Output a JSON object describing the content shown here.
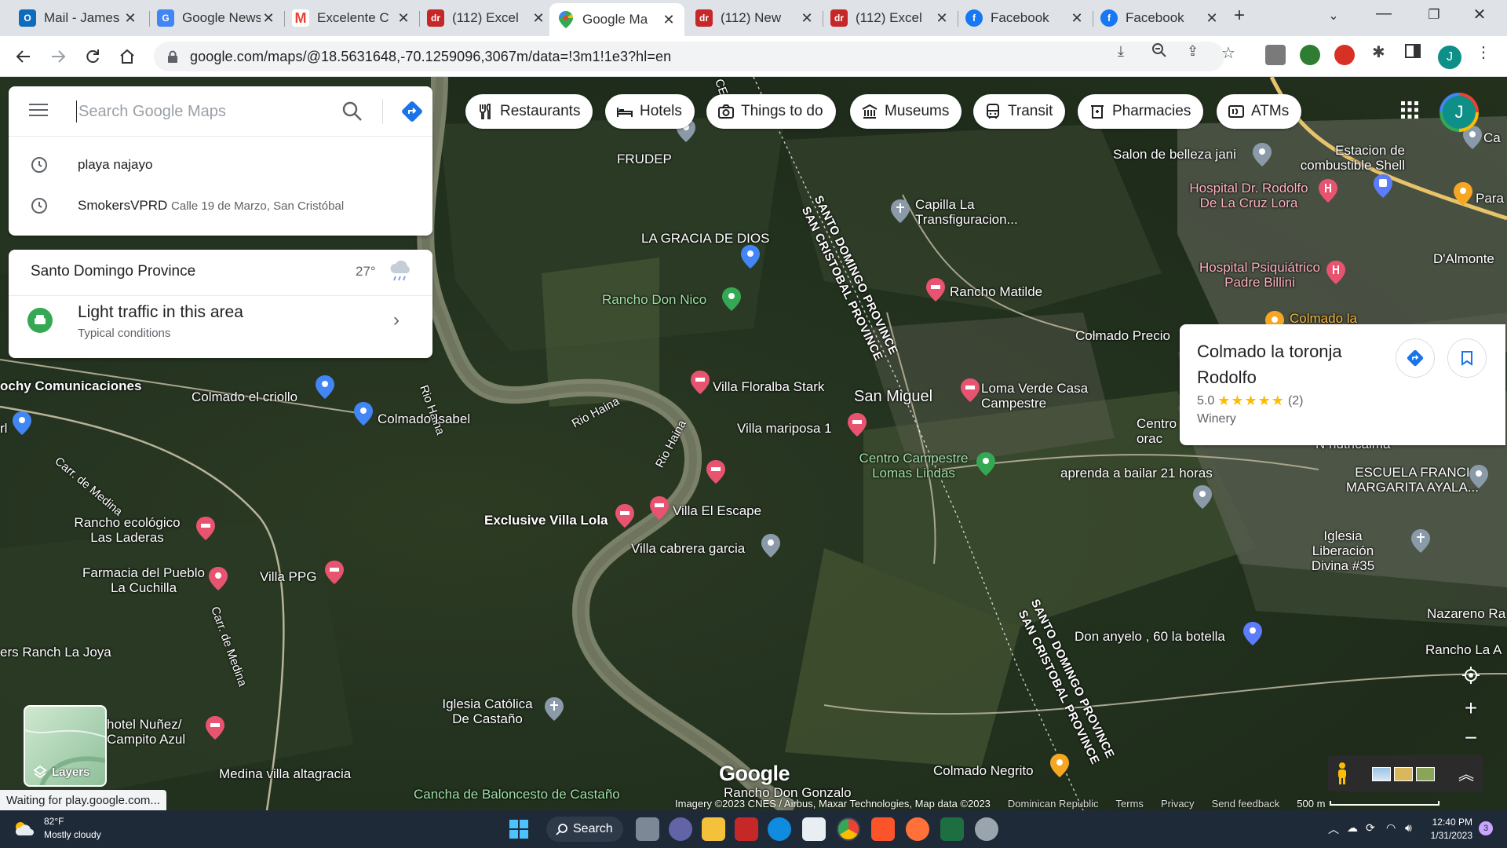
{
  "browser": {
    "tabs": [
      {
        "title": "Mail - James",
        "icon": "outlook-icon",
        "color": "#0f6cbd",
        "glyph": "O"
      },
      {
        "title": "Google News",
        "icon": "google-news-icon",
        "color": "#4285f4",
        "glyph": "G"
      },
      {
        "title": "Excelente C",
        "icon": "gmail-icon",
        "color": "#ea4335",
        "glyph": "M"
      },
      {
        "title": "(112) Excel",
        "icon": "dr-icon",
        "color": "#c62828",
        "glyph": "dr"
      },
      {
        "title": "Google Ma",
        "icon": "google-maps-icon",
        "color": "#34a853",
        "glyph": "◆",
        "active": true
      },
      {
        "title": "(112) New",
        "icon": "dr-icon",
        "color": "#c62828",
        "glyph": "dr"
      },
      {
        "title": "(112) Excel",
        "icon": "dr-icon",
        "color": "#c62828",
        "glyph": "dr"
      },
      {
        "title": "Facebook",
        "icon": "facebook-icon",
        "color": "#1877f2",
        "glyph": "f"
      },
      {
        "title": "Facebook",
        "icon": "facebook-icon",
        "color": "#1877f2",
        "glyph": "f"
      }
    ],
    "new_tab": "+",
    "url": "google.com/maps/@18.5631648,-70.1259096,3067m/data=!3m1!1e3?hl=en",
    "profile_initial": "J"
  },
  "search": {
    "placeholder": "Search Google Maps",
    "recents": [
      {
        "title": "playa najayo",
        "sub": ""
      },
      {
        "title": "SmokersVPRD",
        "sub": "Calle 19 de Marzo, San Cristóbal"
      }
    ]
  },
  "weather_card": {
    "region": "Santo Domingo Province",
    "temperature": "27°",
    "traffic_title": "Light traffic in this area",
    "traffic_sub": "Typical conditions"
  },
  "chips": [
    {
      "label": "Restaurants",
      "icon": "fork-knife-icon"
    },
    {
      "label": "Hotels",
      "icon": "bed-icon"
    },
    {
      "label": "Things to do",
      "icon": "camera-icon"
    },
    {
      "label": "Museums",
      "icon": "museum-icon"
    },
    {
      "label": "Transit",
      "icon": "bus-icon"
    },
    {
      "label": "Pharmacies",
      "icon": "pharmacy-icon"
    },
    {
      "label": "ATMs",
      "icon": "atm-icon"
    }
  ],
  "map_profile_initial": "J",
  "place_card": {
    "name": "Colmado la toronja Rodolfo",
    "rating": "5.0",
    "stars": "★★★★★",
    "reviews": "(2)",
    "category": "Winery"
  },
  "map_labels": {
    "frudep": "FRUDEP",
    "la_gracia": "LA GRACIA DE DIOS",
    "rancho_don_nico": "Rancho Don Nico",
    "capilla": "Capilla La Transfiguracion...",
    "rancho_matilde": "Rancho Matilde",
    "salon": "Salon de belleza jani",
    "estacion": "Estacion de combustible Shell",
    "hospital_cruz": "Hospital Dr. Rodolfo De La Cruz Lora",
    "hospital_psi": "Hospital Psiquiátrico Padre Billini",
    "para": "Para",
    "ca": "Ca",
    "dalmonte": "D'Almonte",
    "colmado_la": "Colmado la",
    "colmado_precio": "Colmado Precio",
    "san_miguel": "San Miguel",
    "loma_verde": "Loma Verde Casa Campestre",
    "villa_floralba": "Villa Floralba Stark",
    "villa_mariposa": "Villa mariposa 1",
    "centro_campestre": "Centro Campestre Lomas Lindas",
    "centro_orac": "Centro orac",
    "aprenda": "aprenda a bailar 21 horas",
    "n_nutricalma": "N nutricalma",
    "escuela": "ESCUELA FRANCIA MARGARITA AYALA...",
    "rio_haina_1": "Rio Haina",
    "rio_haina_2": "Rio Haina",
    "rio_haina_3": "Rio Haina",
    "ochy": "ochy Comunicaciones",
    "colmado_criollo": "Colmado el criollo",
    "colmado_isabel": "Colmado Isabel",
    "carr_medina_1": "Carr. de Medina",
    "carr_medina_2": "Carr. de Medina",
    "rancho_ecologico": "Rancho ecológico Las Laderas",
    "farmacia": "Farmacia del Pueblo La Cuchilla",
    "villa_ppg": "Villa PPG",
    "exclusive_villa": "Exclusive Villa Lola",
    "villa_escape": "Villa El Escape",
    "villa_cabrera": "Villa cabrera garcia",
    "iglesia_liberacion": "Iglesia Liberación Divina #35",
    "nazareno": "Nazareno Ra",
    "don_anyelo": "Don anyelo , 60 la botella",
    "rancho_la": "Rancho La A",
    "ranch_joya": "ers Ranch La Joya",
    "iglesia_castano": "Iglesia Católica De Castaño",
    "hotel_nunez": "hotel Nuñez/ Campito Azul",
    "medina_villa": "Medina villa altagracia",
    "rancho_gonzalo": "Rancho Don Gonzalo",
    "cancha": "Cancha de Baloncesto de Castaño",
    "colmado_negrito": "Colmado Negrito",
    "province_1a": "SANTO DOMINGO PROVINCE",
    "province_1b": "SAN CRISTOBAL PROVINCE",
    "province_2a": "SANTO DOMINGO PROVINCE",
    "province_2b": "SAN CRISTOBAL PROVINCE",
    "ce": "CE",
    "rl": "rl"
  },
  "layers_label": "Layers",
  "google_logo": "Google",
  "attribution": {
    "imagery": "Imagery ©2023 CNES / Airbus, Maxar Technologies, Map data ©2023",
    "country": "Dominican Republic",
    "terms": "Terms",
    "privacy": "Privacy",
    "feedback": "Send feedback",
    "scale": "500 m"
  },
  "status_text": "Waiting for play.google.com...",
  "taskbar": {
    "temp": "82°F",
    "condition": "Mostly cloudy",
    "search_label": "Search",
    "time": "12:40 PM",
    "date": "1/31/2023",
    "notifications": "3"
  },
  "colors": {
    "accent": "#1a73e8",
    "traffic_green": "#34a853",
    "star": "#fbbc04",
    "hotel_pink": "#e8546f"
  }
}
